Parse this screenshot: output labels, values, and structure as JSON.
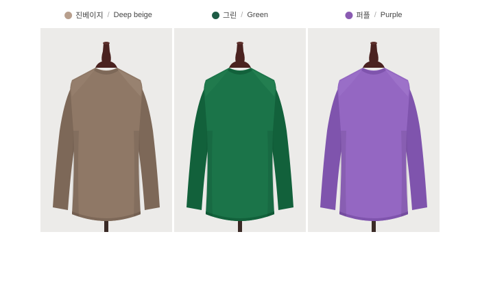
{
  "colors": [
    {
      "name_ko": "진베이지",
      "separator": "/",
      "name_en": "Deep beige",
      "swatch": "#b89f8d",
      "sweater": "#8f7866",
      "sweater_shade": "#7d6858",
      "sweater_light": "#a08a78"
    },
    {
      "name_ko": "그린",
      "separator": "/",
      "name_en": "Green",
      "swatch": "#1d5b45",
      "sweater": "#1b7449",
      "sweater_shade": "#12613b",
      "sweater_light": "#2a8656"
    },
    {
      "name_ko": "퍼플",
      "separator": "/",
      "name_en": "Purple",
      "swatch": "#8a5bb2",
      "sweater": "#9467c2",
      "sweater_shade": "#7f54ad",
      "sweater_light": "#a47cd0"
    }
  ],
  "mannequin": {
    "wood": "#4a2220",
    "stand": "#3a2a26",
    "background": "#ecebe9"
  }
}
